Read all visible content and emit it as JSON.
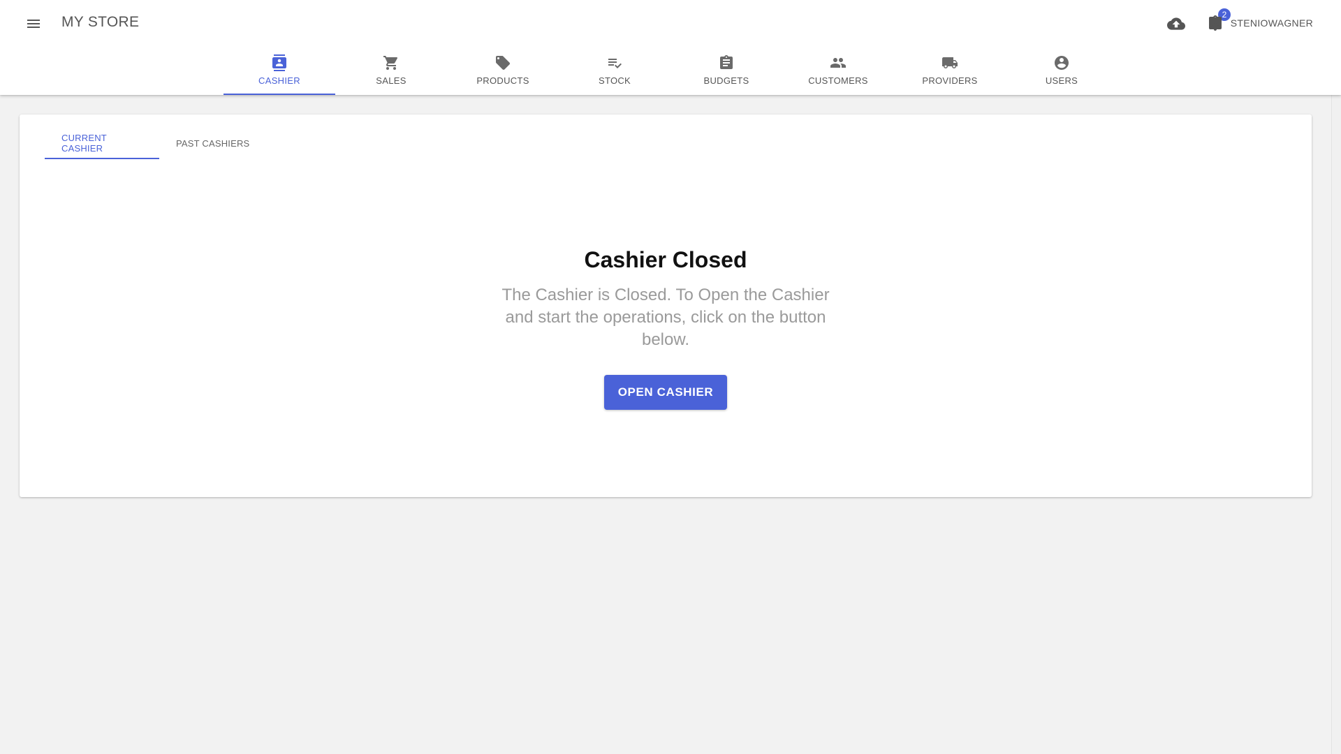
{
  "app": {
    "title": "MY STORE"
  },
  "header": {
    "notifications_count": "2",
    "user_name": "STENIOWAGNER"
  },
  "nav": {
    "items": [
      {
        "label": "CASHIER",
        "icon": "cashier-icon",
        "active": true
      },
      {
        "label": "SALES",
        "icon": "cart-icon",
        "active": false
      },
      {
        "label": "PRODUCTS",
        "icon": "tag-icon",
        "active": false
      },
      {
        "label": "STOCK",
        "icon": "checklist-icon",
        "active": false
      },
      {
        "label": "BUDGETS",
        "icon": "clipboard-icon",
        "active": false
      },
      {
        "label": "CUSTOMERS",
        "icon": "people-icon",
        "active": false
      },
      {
        "label": "PROVIDERS",
        "icon": "truck-icon",
        "active": false
      },
      {
        "label": "USERS",
        "icon": "account-circle-icon",
        "active": false
      }
    ]
  },
  "subtabs": {
    "current": "CURRENT CASHIER",
    "past": "PAST CASHIERS"
  },
  "empty_state": {
    "title": "Cashier Closed",
    "text": "The Cashier is Closed. To Open the Cashier and start the operations, click on the button below.",
    "button": "OPEN CASHIER"
  },
  "colors": {
    "accent": "#4a62d8",
    "background": "#f2f2f2",
    "muted_text": "#9a9a9a"
  }
}
